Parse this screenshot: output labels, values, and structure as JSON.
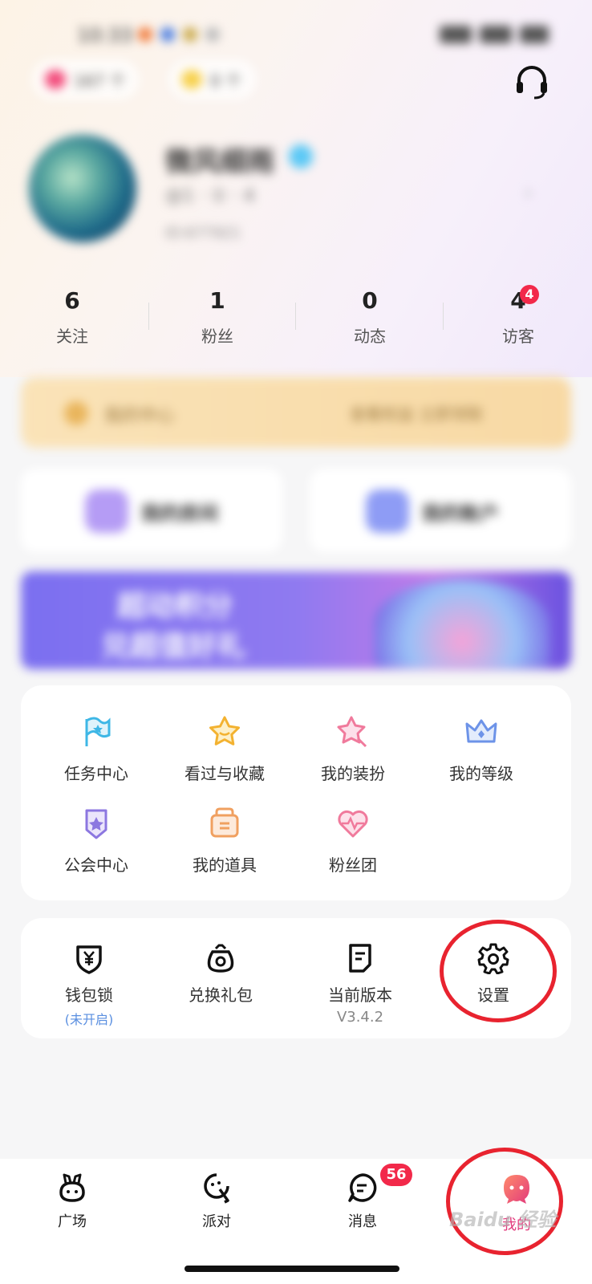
{
  "status_bar": {
    "time": "10:33"
  },
  "pills": {
    "left": "167 个",
    "right": "0 个"
  },
  "profile": {
    "nickname": "微风细雨",
    "subline": "@1 · ① · 4",
    "id_text": "ID:677921"
  },
  "stats": [
    {
      "num": "6",
      "label": "关注"
    },
    {
      "num": "1",
      "label": "粉丝"
    },
    {
      "num": "0",
      "label": "动态"
    },
    {
      "num": "4",
      "label": "访客",
      "badge": "4"
    }
  ],
  "banners": {
    "yellow_left": "我的中心",
    "yellow_right": "查看权益 立即领取",
    "card_left": "我的房间",
    "card_right": "我的账户",
    "purple_line1": "超动积分",
    "purple_line2": "兑超值好礼"
  },
  "grid": [
    {
      "label": "任务中心",
      "icon": "flag-icon"
    },
    {
      "label": "看过与收藏",
      "icon": "star-icon"
    },
    {
      "label": "我的装扮",
      "icon": "dress-up-icon"
    },
    {
      "label": "我的等级",
      "icon": "crown-icon"
    },
    {
      "label": "公会中心",
      "icon": "guild-icon"
    },
    {
      "label": "我的道具",
      "icon": "props-icon"
    },
    {
      "label": "粉丝团",
      "icon": "heart-pulse-icon"
    }
  ],
  "tools": {
    "wallet_lock": {
      "label": "钱包锁",
      "status": "(未开启)"
    },
    "gift_redeem": {
      "label": "兑换礼包"
    },
    "version": {
      "label": "当前版本",
      "value": "V3.4.2"
    },
    "settings": {
      "label": "设置"
    }
  },
  "bottom_nav": [
    {
      "label": "广场",
      "icon": "rabbit-icon"
    },
    {
      "label": "派对",
      "icon": "party-icon"
    },
    {
      "label": "消息",
      "icon": "message-icon",
      "badge": "56"
    },
    {
      "label": "我的",
      "icon": "profile-mascot-icon"
    }
  ],
  "watermark": "Baidu 经验",
  "colors": {
    "accent_red": "#e8232f",
    "badge_red": "#f2294a",
    "link_blue": "#5a8fe0"
  }
}
